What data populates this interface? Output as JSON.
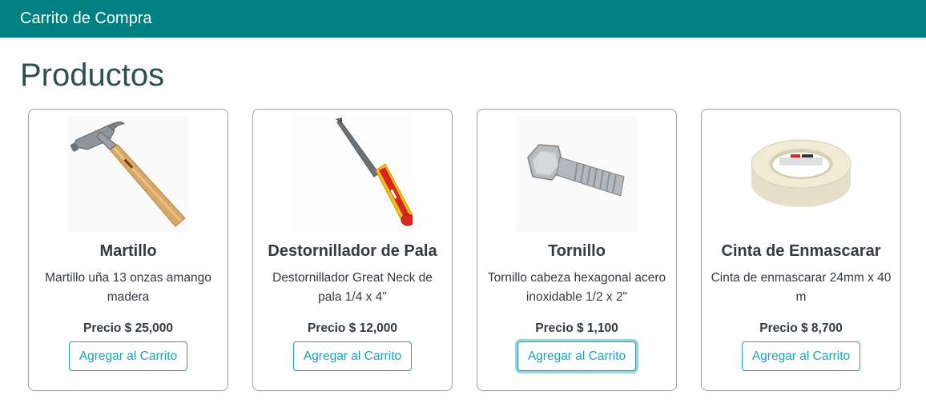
{
  "header": {
    "brand": "Carrito de Compra"
  },
  "page": {
    "title": "Productos"
  },
  "products": [
    {
      "name": "Martillo",
      "description": "Martillo uña 13 onzas amango madera",
      "price": "Precio $ 25,000",
      "button": "Agregar al Carrito",
      "image": "hammer-image"
    },
    {
      "name": "Destornillador de Pala",
      "description": "Destornillador Great Neck de pala 1/4 x 4\"",
      "price": "Precio $ 12,000",
      "button": "Agregar al Carrito",
      "image": "screwdriver-image"
    },
    {
      "name": "Tornillo",
      "description": "Tornillo cabeza hexagonal acero inoxidable 1/2 x 2\"",
      "price": "Precio $ 1,100",
      "button": "Agregar al Carrito",
      "image": "bolt-image"
    },
    {
      "name": "Cinta de Enmascarar",
      "description": "Cinta de enmascarar 24mm x 40 m",
      "price": "Precio $ 8,700",
      "button": "Agregar al Carrito",
      "image": "masking-tape-image"
    }
  ],
  "colors": {
    "navbar": "#008080",
    "accent": "#17a2b8",
    "title": "#2f4f4f"
  }
}
